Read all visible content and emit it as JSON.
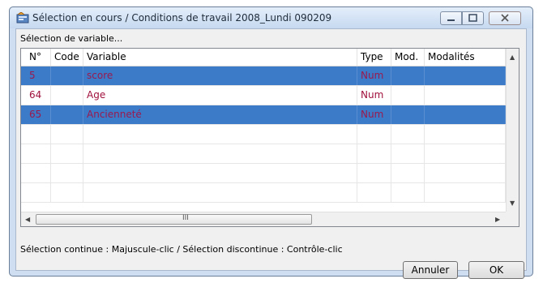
{
  "window": {
    "title": "Sélection en cours / Conditions de travail 2008_Lundi 090209"
  },
  "panel": {
    "selection_label": "Sélection de variable..."
  },
  "table": {
    "columns": [
      "N°",
      "Code",
      "Variable",
      "Type",
      "Mod.",
      "Modalités"
    ],
    "rows": [
      {
        "n": "5",
        "code": "",
        "variable": "score",
        "type": "Num",
        "mod": "",
        "modalites": "",
        "selected": true
      },
      {
        "n": "64",
        "code": "",
        "variable": "Age",
        "type": "Num",
        "mod": "",
        "modalites": "",
        "selected": false
      },
      {
        "n": "65",
        "code": "",
        "variable": "Ancienneté",
        "type": "Num",
        "mod": "",
        "modalites": "",
        "selected": true
      }
    ]
  },
  "hint": "Sélection continue : Majuscule-clic / Sélection discontinue : Contrôle-clic",
  "buttons": {
    "cancel": "Annuler",
    "ok": "OK"
  },
  "colors": {
    "selected_row": "#3b7bc8",
    "row_text": "#a0103c"
  },
  "icons": {
    "app": "app-icon",
    "minimize": "minimize-icon",
    "maximize": "maximize-icon",
    "close": "close-icon",
    "scroll_up": "arrow-up-icon",
    "scroll_down": "arrow-down-icon",
    "scroll_left": "arrow-left-icon",
    "scroll_right": "arrow-right-icon"
  }
}
